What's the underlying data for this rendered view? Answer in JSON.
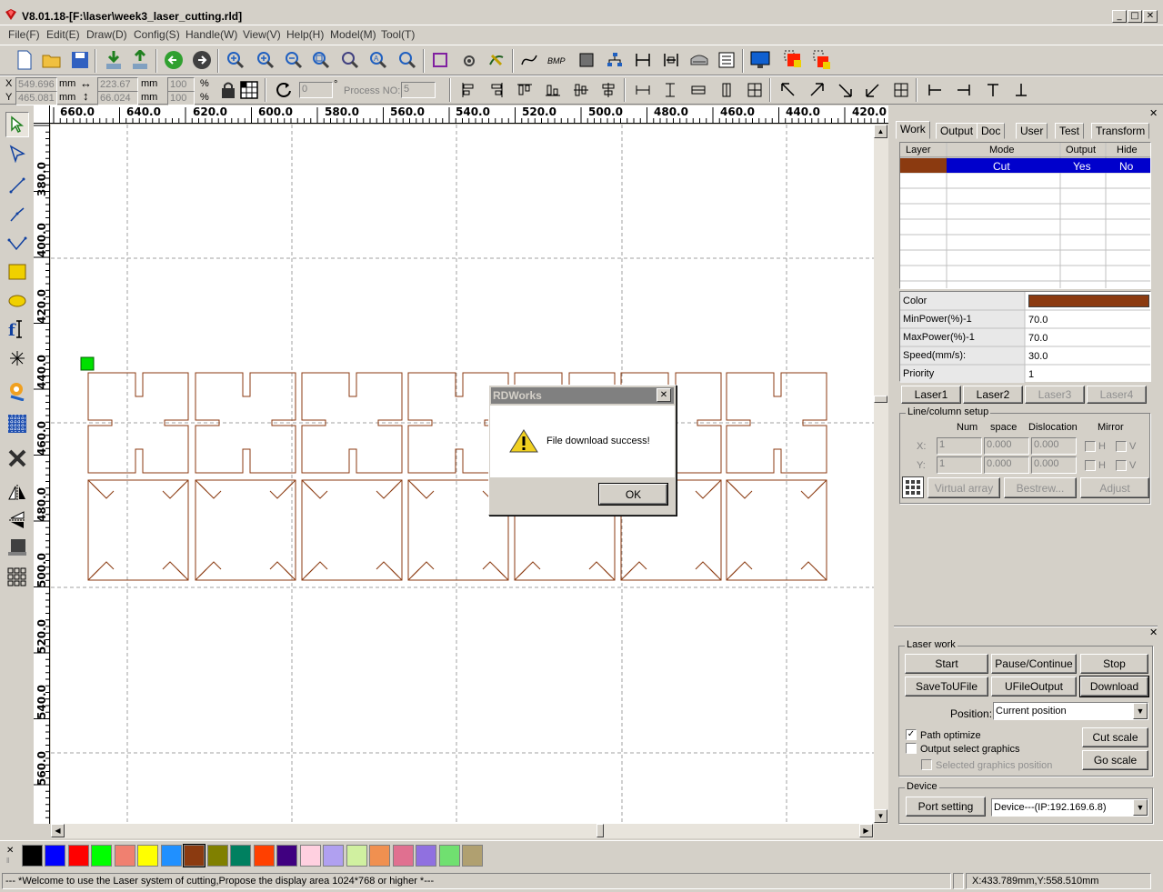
{
  "window": {
    "title": "V8.01.18-[F:\\laser\\week3_laser_cutting.rld]"
  },
  "menu": [
    "File(F)",
    "Edit(E)",
    "Draw(D)",
    "Config(S)",
    "Handle(W)",
    "View(V)",
    "Help(H)",
    "Model(M)",
    "Tool(T)"
  ],
  "toolbar2": {
    "x_label": "X",
    "y_label": "Y",
    "x_value": "549.696",
    "y_value": "465.081",
    "unit": "mm",
    "width_value": "223.67",
    "height_value": "66.024",
    "scale_x": "100",
    "scale_y": "100",
    "percent": "%",
    "rotate_value": "0",
    "degree": "°",
    "process_no_label": "Process NO:",
    "process_no_value": "5"
  },
  "hruler": [
    "660.0",
    "640.0",
    "620.0",
    "600.0",
    "580.0",
    "560.0",
    "540.0",
    "520.0",
    "500.0",
    "480.0",
    "460.0",
    "440.0",
    "420.0"
  ],
  "vruler": [
    "380.0",
    "400.0",
    "420.0",
    "440.0",
    "460.0",
    "480.0",
    "500.0",
    "520.0",
    "540.0",
    "560.0"
  ],
  "dialog": {
    "title": "RDWorks",
    "message": "File download success!",
    "ok": "OK",
    "close": "✕"
  },
  "right_panel": {
    "tabs": [
      "Work",
      "Output",
      "Doc",
      "User",
      "Test",
      "Transform"
    ],
    "layer_table": {
      "headers": [
        "Layer",
        "Mode",
        "Output",
        "Hide"
      ],
      "rows": [
        {
          "color": "#8b3a10",
          "mode": "Cut",
          "output": "Yes",
          "hide": "No"
        }
      ]
    },
    "props": {
      "color_label": "Color",
      "color": "#8b3a10",
      "min_power_label": "MinPower(%)-1",
      "min_power": "70.0",
      "max_power_label": "MaxPower(%)-1",
      "max_power": "70.0",
      "speed_label": "Speed(mm/s):",
      "speed": "30.0",
      "priority_label": "Priority",
      "priority": "1"
    },
    "lasers": [
      "Laser1",
      "Laser2",
      "Laser3",
      "Laser4"
    ],
    "linecol": {
      "caption": "Line/column setup",
      "num": "Num",
      "space": "space",
      "dislocation": "Dislocation",
      "mirror": "Mirror",
      "x": "X:",
      "y": "Y:",
      "x_num": "1",
      "x_space": "0.000",
      "x_disl": "0.000",
      "y_num": "1",
      "y_space": "0.000",
      "y_disl": "0.000",
      "h": "H",
      "v": "V",
      "virtual_array": "Virtual array",
      "bestrew": "Bestrew...",
      "adjust": "Adjust"
    }
  },
  "laser_work": {
    "caption": "Laser work",
    "start": "Start",
    "pause": "Pause/Continue",
    "stop": "Stop",
    "save_to_ufile": "SaveToUFile",
    "ufile_output": "UFileOutput",
    "download": "Download",
    "position_label": "Position:",
    "position_value": "Current position",
    "path_optimize": "Path optimize",
    "output_select": "Output select graphics",
    "selected_pos": "Selected graphics position",
    "cut_scale": "Cut scale",
    "go_scale": "Go scale",
    "device_caption": "Device",
    "port_setting": "Port setting",
    "device_value": "Device---(IP:192.169.6.8)"
  },
  "palette": [
    "#000000",
    "#0000ff",
    "#ff0000",
    "#00ff00",
    "#f08070",
    "#ffff00",
    "#2090ff",
    "#8b3a10",
    "#808000",
    "#008060",
    "#ff4000",
    "#400080",
    "#ffd0e0",
    "#b0a0f0",
    "#d0f0a0",
    "#f09050",
    "#e07090",
    "#9070e0",
    "#70e070",
    "#b0a070"
  ],
  "status": {
    "message": "--- *Welcome to use the Laser system of cutting,Propose the display area 1024*768 or higher *---",
    "coords": "X:433.789mm,Y:558.510mm"
  }
}
